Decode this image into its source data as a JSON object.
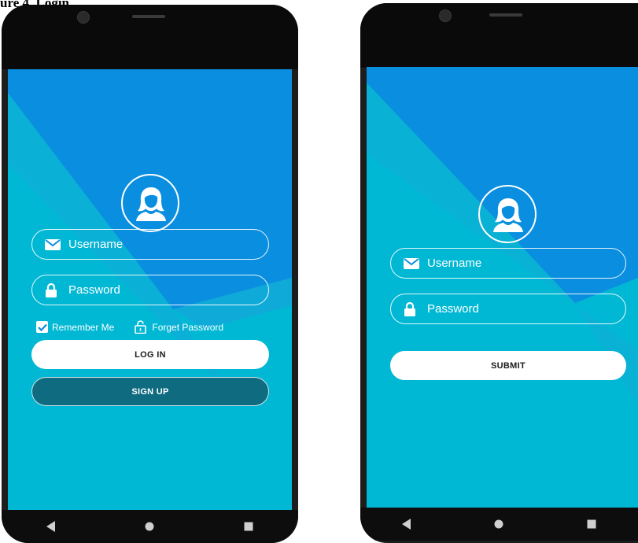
{
  "caption": "ure 4. Login",
  "colors": {
    "screen_base": "#00b8d4",
    "screen_blue": "#0a8ee0",
    "field_border": "#ffffff",
    "signup_bg": "#0f6b80"
  },
  "login_screen": {
    "avatar_icon": "woman-avatar-icon",
    "username": {
      "icon": "mail-icon",
      "placeholder": "Username"
    },
    "password": {
      "icon": "lock-icon",
      "placeholder": "Password"
    },
    "remember_me": {
      "checked": true,
      "label": "Remember Me"
    },
    "forget_password": {
      "icon": "unlock-icon",
      "label": "Forget Password"
    },
    "login_button": "LOG IN",
    "signup_button": "SIGN UP"
  },
  "submit_screen": {
    "avatar_icon": "woman-avatar-icon",
    "username": {
      "icon": "mail-icon",
      "placeholder": "Username"
    },
    "password": {
      "icon": "lock-icon",
      "placeholder": "Password"
    },
    "submit_button": "SUBMIT"
  },
  "nav": {
    "back": "back-icon",
    "home": "home-icon",
    "recents": "recents-icon"
  }
}
